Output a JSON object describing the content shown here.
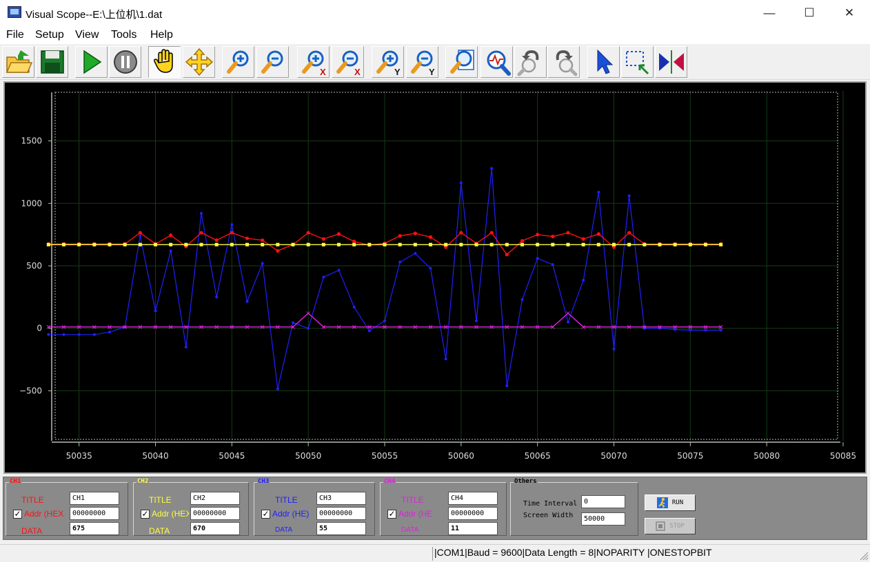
{
  "window": {
    "title": "Visual Scope--E:\\上位机\\1.dat",
    "minimize_icon": "minimize-icon",
    "maximize_icon": "maximize-icon",
    "close_icon": "close-icon"
  },
  "menu": [
    "File",
    "Setup",
    "View",
    "Tools",
    "Help"
  ],
  "toolbar": [
    {
      "name": "open-folder-icon"
    },
    {
      "name": "save-icon"
    },
    {
      "name": "run-play-icon"
    },
    {
      "name": "pause-icon"
    },
    {
      "name": "hand-pan-icon",
      "pressed": true
    },
    {
      "name": "move-arrows-icon"
    },
    {
      "name": "zoom-in-icon"
    },
    {
      "name": "zoom-out-icon"
    },
    {
      "name": "zoom-in-x-icon",
      "axis": "X"
    },
    {
      "name": "zoom-out-x-icon",
      "axis": "X"
    },
    {
      "name": "zoom-in-y-icon",
      "axis": "Y"
    },
    {
      "name": "zoom-out-y-icon",
      "axis": "Y"
    },
    {
      "name": "zoom-fit-icon"
    },
    {
      "name": "zoom-waveform-icon"
    },
    {
      "name": "zoom-undo-icon"
    },
    {
      "name": "zoom-redo-icon"
    },
    {
      "name": "pointer-arrow-icon"
    },
    {
      "name": "select-region-icon"
    },
    {
      "name": "cursor-marker-icon"
    }
  ],
  "chart_data": {
    "type": "line",
    "xlim": [
      50033.3,
      50085
    ],
    "ylim": [
      -900,
      1900
    ],
    "x_ticks": [
      50035,
      50040,
      50045,
      50050,
      50055,
      50060,
      50065,
      50070,
      50075,
      50080,
      50085
    ],
    "y_ticks": [
      1500,
      1000,
      500,
      0,
      -500
    ],
    "x_tick_labels": [
      "50035",
      "50040",
      "50045",
      "50050",
      "50055",
      "50060",
      "50065",
      "50070",
      "50075",
      "50080",
      "50085"
    ],
    "y_tick_labels": [
      "1500",
      "1000",
      "500",
      "0",
      "−500"
    ],
    "grid": true,
    "background": "#000000",
    "x": [
      50033,
      50034,
      50035,
      50036,
      50037,
      50038,
      50039,
      50040,
      50041,
      50042,
      50043,
      50044,
      50045,
      50046,
      50047,
      50048,
      50049,
      50050,
      50051,
      50052,
      50053,
      50054,
      50055,
      50056,
      50057,
      50058,
      50059,
      50060,
      50061,
      50062,
      50063,
      50064,
      50065,
      50066,
      50067,
      50068,
      50069,
      50070,
      50071,
      50072,
      50073,
      50074,
      50075,
      50076,
      50077
    ],
    "series": [
      {
        "color": "#ffff40",
        "marker": "square",
        "values": [
          670,
          670,
          670,
          670,
          670,
          670,
          670,
          670,
          670,
          670,
          670,
          670,
          670,
          670,
          670,
          670,
          670,
          670,
          670,
          670,
          670,
          670,
          670,
          670,
          670,
          670,
          670,
          670,
          670,
          670,
          670,
          670,
          670,
          670,
          670,
          670,
          670,
          670,
          670,
          670,
          670,
          670,
          670,
          670,
          670
        ]
      },
      {
        "color": "#ff1010",
        "marker": "circle",
        "values": [
          675,
          675,
          675,
          675,
          675,
          675,
          765,
          675,
          745,
          655,
          765,
          705,
          765,
          720,
          705,
          620,
          670,
          765,
          715,
          755,
          695,
          665,
          680,
          740,
          760,
          730,
          650,
          765,
          680,
          765,
          590,
          700,
          750,
          735,
          765,
          715,
          755,
          650,
          765,
          675,
          675,
          675,
          675,
          675,
          675
        ]
      },
      {
        "color": "#2020ff",
        "marker": "dot",
        "values": [
          -50,
          -50,
          -50,
          -50,
          -30,
          10,
          740,
          140,
          620,
          -150,
          920,
          250,
          830,
          215,
          520,
          -485,
          45,
          0,
          410,
          465,
          170,
          -20,
          60,
          530,
          600,
          480,
          -245,
          1165,
          60,
          1280,
          -460,
          230,
          560,
          510,
          50,
          385,
          1090,
          -165,
          1060,
          0,
          0,
          -10,
          -15,
          -15,
          -15
        ]
      },
      {
        "color": "#e020e0",
        "marker": "x",
        "values": [
          11,
          11,
          11,
          11,
          11,
          11,
          11,
          11,
          11,
          11,
          11,
          11,
          11,
          11,
          11,
          11,
          11,
          120,
          11,
          11,
          11,
          11,
          11,
          11,
          11,
          11,
          11,
          11,
          11,
          11,
          11,
          11,
          11,
          11,
          120,
          11,
          11,
          11,
          11,
          11,
          11,
          11,
          11,
          11,
          11
        ]
      }
    ]
  },
  "channels": [
    {
      "group_label": "CH1",
      "color": "#ff1010",
      "title_label": "TITLE",
      "title_value": "CH1",
      "addr_label": "Addr (HEX",
      "addr_value": "00000000",
      "data_label": "DATA",
      "data_value": "675",
      "checked": true
    },
    {
      "group_label": "CH2",
      "color": "#ffff40",
      "title_label": "TITLE",
      "title_value": "CH2",
      "addr_label": "Addr (HEX",
      "addr_value": "00000000",
      "data_label": "DATA",
      "data_value": "670",
      "checked": true
    },
    {
      "group_label": "CH3",
      "color": "#2020ff",
      "title_label": "TITLE",
      "title_value": "CH3",
      "addr_label": "Addr (HE)",
      "addr_value": "00000000",
      "data_label": "DATA",
      "data_value": "55",
      "checked": true
    },
    {
      "group_label": "CH4",
      "color": "#e020e0",
      "title_label": "TITLE",
      "title_value": "CH4",
      "addr_label": "Addr (HE",
      "addr_value": "00000000",
      "data_label": "DATA",
      "data_value": "11",
      "checked": true
    }
  ],
  "others": {
    "group_label": "Others",
    "time_interval_label": "Time Interval",
    "time_interval_value": "0",
    "screen_width_label": "Screen Width",
    "screen_width_value": "50000"
  },
  "buttons": {
    "run_label": "RUN",
    "stop_label": "STOP"
  },
  "status": {
    "text": "|COM1|Baud = 9600|Data Length = 8|NOPARITY  |ONESTOPBIT"
  }
}
